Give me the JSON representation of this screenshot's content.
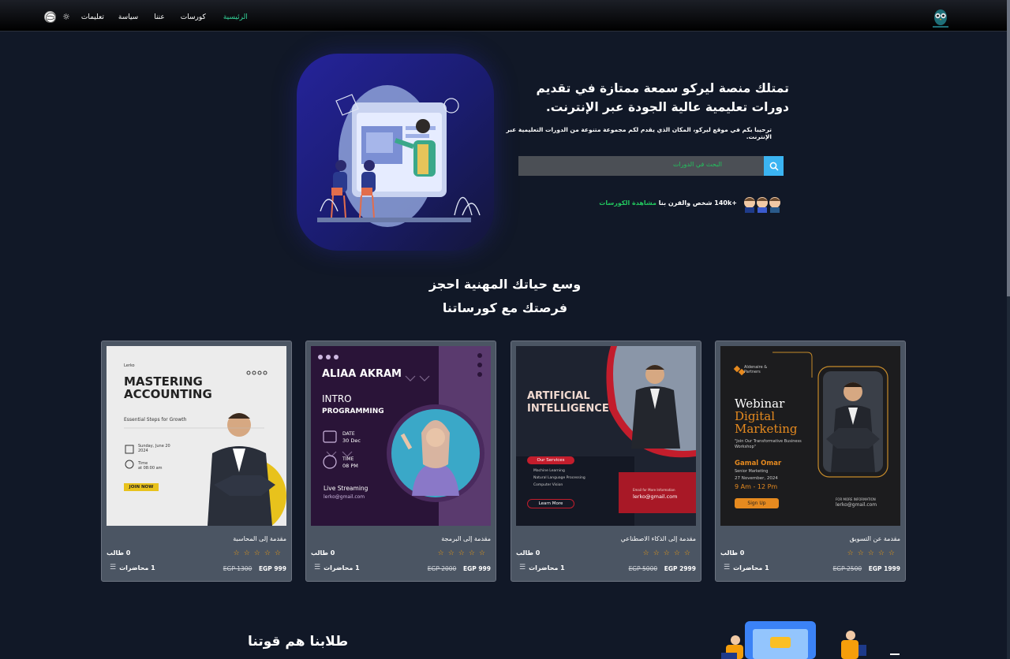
{
  "nav": {
    "links": [
      "تعليمات",
      "سياسة",
      "عننا",
      "كورسات",
      "الرئيسية"
    ],
    "active": "الرئيسية",
    "theme_icon": "sun-icon",
    "language_icon": "globe-icon",
    "logo_icon": "owl-logo"
  },
  "hero": {
    "title": "تمتلك منصة ليركو سمعة ممتازة في تقديم دورات تعليمية عالية الجودة عبر الإنترنت.",
    "subtitle": "ترحيبا بكم في موقع ليركو، المكان الذي يقدم لكم مجموعة متنوعة من الدورات التعليمية عبر الإنترنت.",
    "search_placeholder": "البحث في الدورات",
    "social_count": "+140k",
    "social_text": "شخص والقرن بنا",
    "social_link": "مشاهدة الكورسات"
  },
  "section": {
    "title_line1": "وسع حياتك المهنية احجز",
    "title_line2": "فرصتك مع كورساتنا"
  },
  "courses": [
    {
      "title": "مقدمة عن التسويق",
      "students": "0 طالب",
      "old_price": "EGP 2500",
      "price": "EGP 1999",
      "lectures": "1 محاضرات",
      "thumb": {
        "brand": "Aldenaire & Partners",
        "heading1": "Webinar",
        "heading2": "Digital",
        "heading3": "Marketing",
        "tagline": "\"Join Our Transformative Business Workshop\"",
        "speaker": "Gamal Omar",
        "role": "Senior Marketing",
        "date": "27 November, 2024",
        "time": "9 Am - 12 Pm",
        "cta": "Sign Up",
        "contact_label": "FOR MORE INFORMATION",
        "contact": "lerko@gmail.com"
      }
    },
    {
      "title": "مقدمة إلى الذكاء الاصطناعي",
      "students": "0 طالب",
      "old_price": "EGP 5000",
      "price": "EGP 2999",
      "lectures": "1 محاضرات",
      "thumb": {
        "heading1": "ARTIFICIAL",
        "heading2": "INTELLIGENCE",
        "services_label": "Our Services",
        "services": [
          "Machine Learning",
          "Natural Language Processing",
          "Computer Vision"
        ],
        "cta": "Learn More",
        "contact_label": "Email for More Information",
        "contact": "lerko@gmail.com"
      }
    },
    {
      "title": "مقدمة إلى البرمجة",
      "students": "0 طالب",
      "old_price": "EGP 2000",
      "price": "EGP 999",
      "lectures": "1 محاضرات",
      "thumb": {
        "name": "ALIAA AKRAM",
        "heading1": "INTRO",
        "heading2": "PROGRAMMING",
        "date_label": "DATE",
        "date": "30 Dec",
        "time_label": "TIME",
        "time": "08 PM",
        "stream": "Live Streaming",
        "contact": "lerko@gmail.com"
      }
    },
    {
      "title": "مقدمة إلى المحاسبة",
      "students": "0 طالب",
      "old_price": "EGP 1300",
      "price": "EGP 999",
      "lectures": "1 محاضرات",
      "thumb": {
        "brand": "Lerko",
        "heading1": "MASTERING",
        "heading2": "ACCOUNTING",
        "tagline": "Essential Steps for Growth",
        "date": "Sunday, June 20\n2024",
        "time": "Time\nat 08:00 am",
        "cta": "JOIN NOW"
      }
    }
  ],
  "bottom": {
    "title": "طلابنا هم قوتنا"
  },
  "colors": {
    "background": "#111827",
    "card": "#4b5563",
    "accent_green": "#22c55e",
    "search_button": "#3bb4f2",
    "star": "#f59e0b"
  }
}
